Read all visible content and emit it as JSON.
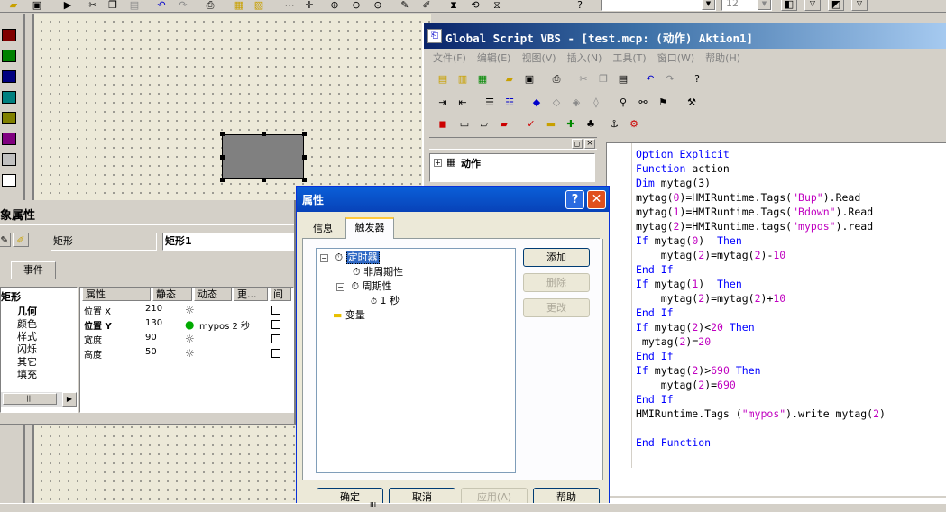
{
  "top_toolbar": {
    "font_size_value": "12",
    "font_name_value": ""
  },
  "palette": {
    "colors": [
      "#800000",
      "#008000",
      "#000080",
      "#008080",
      "#808000",
      "#800080",
      "#c0c0c0",
      "#ffffff"
    ]
  },
  "properties_panel": {
    "title": "象属性",
    "object_type": "矩形",
    "object_name": "矩形1",
    "tab_events": "事件",
    "tree_root": "矩形",
    "tree_items": [
      "几何",
      "颜色",
      "样式",
      "闪烁",
      "其它",
      "填充"
    ],
    "grid_headers": [
      "属性",
      "静态",
      "动态",
      "更...",
      "间"
    ],
    "grid_rows": [
      {
        "prop": "位置 X",
        "static": "210",
        "dynamic": ""
      },
      {
        "prop": "位置 Y",
        "static": "130",
        "dynamic": "mypos 2 秒"
      },
      {
        "prop": "宽度",
        "static": "90",
        "dynamic": ""
      },
      {
        "prop": "高度",
        "static": "50",
        "dynamic": ""
      }
    ]
  },
  "dialog": {
    "title": "属性",
    "tab_info": "信息",
    "tab_trigger": "触发器",
    "tree": {
      "timer": "定时器",
      "acyclic": "非周期性",
      "cyclic": "周期性",
      "one_sec": "1 秒",
      "variable": "变量"
    },
    "buttons": {
      "add": "添加",
      "delete": "删除",
      "change": "更改",
      "ok": "确定",
      "cancel": "取消",
      "apply": "应用(A)",
      "help": "帮助"
    }
  },
  "vbs_window": {
    "title": "Global Script VBS - [test.mcp: (动作) Aktion1]",
    "menu": [
      "文件(F)",
      "编辑(E)",
      "视图(V)",
      "插入(N)",
      "工具(T)",
      "窗口(W)",
      "帮助(H)"
    ],
    "tree_root": "动作",
    "code": [
      [
        [
          "kw",
          "Option Explicit"
        ]
      ],
      [
        [
          "kw",
          "Function "
        ],
        [
          "mn",
          "action"
        ]
      ],
      [
        [
          "kw",
          "Dim "
        ],
        [
          "mn",
          "mytag(3)"
        ]
      ],
      [
        [
          "mn",
          "mytag("
        ],
        [
          "nr",
          "0"
        ],
        [
          "mn",
          ")=HMIRuntime.Tags("
        ],
        [
          "st",
          "\"Bup\""
        ],
        [
          "mn",
          ").Read"
        ]
      ],
      [
        [
          "mn",
          "mytag("
        ],
        [
          "nr",
          "1"
        ],
        [
          "mn",
          ")=HMIRuntime.Tags("
        ],
        [
          "st",
          "\"Bdown\""
        ],
        [
          "mn",
          ").Read"
        ]
      ],
      [
        [
          "mn",
          "mytag("
        ],
        [
          "nr",
          "2"
        ],
        [
          "mn",
          ")=HMIRuntime.tags("
        ],
        [
          "st",
          "\"mypos\""
        ],
        [
          "mn",
          ").read"
        ]
      ],
      [
        [
          "kw",
          "If "
        ],
        [
          "mn",
          "mytag("
        ],
        [
          "nr",
          "0"
        ],
        [
          "mn",
          ")  "
        ],
        [
          "kw",
          "Then"
        ]
      ],
      [
        [
          "mn",
          "    mytag("
        ],
        [
          "nr",
          "2"
        ],
        [
          "mn",
          ")=mytag("
        ],
        [
          "nr",
          "2"
        ],
        [
          "mn",
          ")-"
        ],
        [
          "nr",
          "10"
        ]
      ],
      [
        [
          "kw",
          "End If"
        ]
      ],
      [
        [
          "kw",
          "If "
        ],
        [
          "mn",
          "mytag("
        ],
        [
          "nr",
          "1"
        ],
        [
          "mn",
          ")  "
        ],
        [
          "kw",
          "Then"
        ]
      ],
      [
        [
          "mn",
          "    mytag("
        ],
        [
          "nr",
          "2"
        ],
        [
          "mn",
          ")=mytag("
        ],
        [
          "nr",
          "2"
        ],
        [
          "mn",
          ")+"
        ],
        [
          "nr",
          "10"
        ]
      ],
      [
        [
          "kw",
          "End If"
        ]
      ],
      [
        [
          "kw",
          "If "
        ],
        [
          "mn",
          "mytag("
        ],
        [
          "nr",
          "2"
        ],
        [
          "mn",
          ")<"
        ],
        [
          "nr",
          "20"
        ],
        [
          "mn",
          " "
        ],
        [
          "kw",
          "Then"
        ]
      ],
      [
        [
          "mn",
          " mytag("
        ],
        [
          "nr",
          "2"
        ],
        [
          "mn",
          ")="
        ],
        [
          "nr",
          "20"
        ]
      ],
      [
        [
          "kw",
          "End If"
        ]
      ],
      [
        [
          "kw",
          "If "
        ],
        [
          "mn",
          "mytag("
        ],
        [
          "nr",
          "2"
        ],
        [
          "mn",
          ")>"
        ],
        [
          "nr",
          "690"
        ],
        [
          "mn",
          " "
        ],
        [
          "kw",
          "Then"
        ]
      ],
      [
        [
          "mn",
          "    mytag("
        ],
        [
          "nr",
          "2"
        ],
        [
          "mn",
          ")="
        ],
        [
          "nr",
          "690"
        ]
      ],
      [
        [
          "kw",
          "End If"
        ]
      ],
      [
        [
          "mn",
          "HMIRuntime.Tags ("
        ],
        [
          "st",
          "\"mypos\""
        ],
        [
          "mn",
          ").write mytag("
        ],
        [
          "nr",
          "2"
        ],
        [
          "mn",
          ")"
        ]
      ],
      [
        [
          "mn",
          ""
        ]
      ],
      [
        [
          "kw",
          "End Function"
        ]
      ]
    ]
  },
  "status_bar": {
    "scroll_marker": "III"
  }
}
